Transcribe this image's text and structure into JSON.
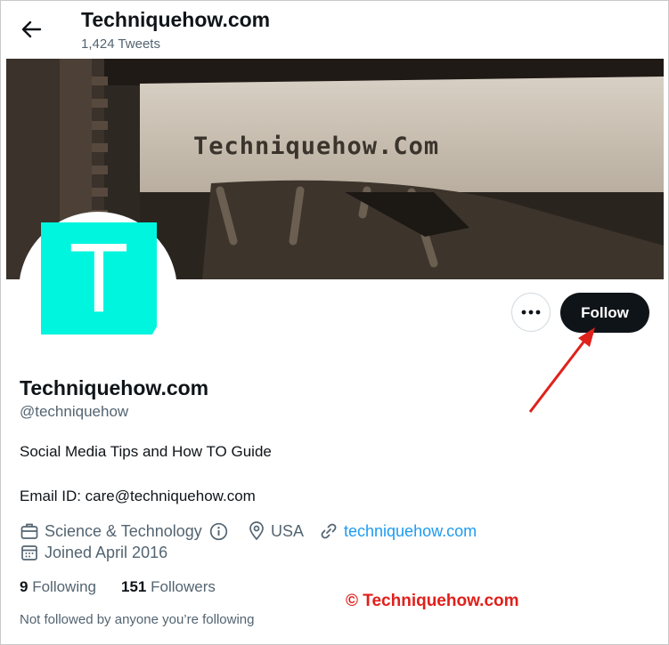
{
  "header": {
    "title": "Techniquehow.com",
    "tweets": "1,424 Tweets"
  },
  "banner": {
    "text": "Techniquehow.Com"
  },
  "avatar": {
    "letter": "T",
    "color": "#00f5de"
  },
  "actions": {
    "follow_label": "Follow"
  },
  "profile": {
    "name": "Techniquehow.com",
    "handle": "@techniquehow",
    "bio_line1": "Social Media Tips and How TO Guide",
    "bio_line2": "Email ID: care@techniquehow.com",
    "category": "Science & Technology",
    "location": "USA",
    "website": "techniquehow.com",
    "joined": "Joined April 2016"
  },
  "stats": {
    "following_count": "9",
    "following_label": "Following",
    "followers_count": "151",
    "followers_label": "Followers"
  },
  "footer": {
    "not_followed": "Not followed by anyone you’re following"
  },
  "watermark": {
    "text": "© Techniquehow.com"
  },
  "colors": {
    "link": "#1d9bf0",
    "button": "#0f1419",
    "annotation": "#e0201b"
  }
}
